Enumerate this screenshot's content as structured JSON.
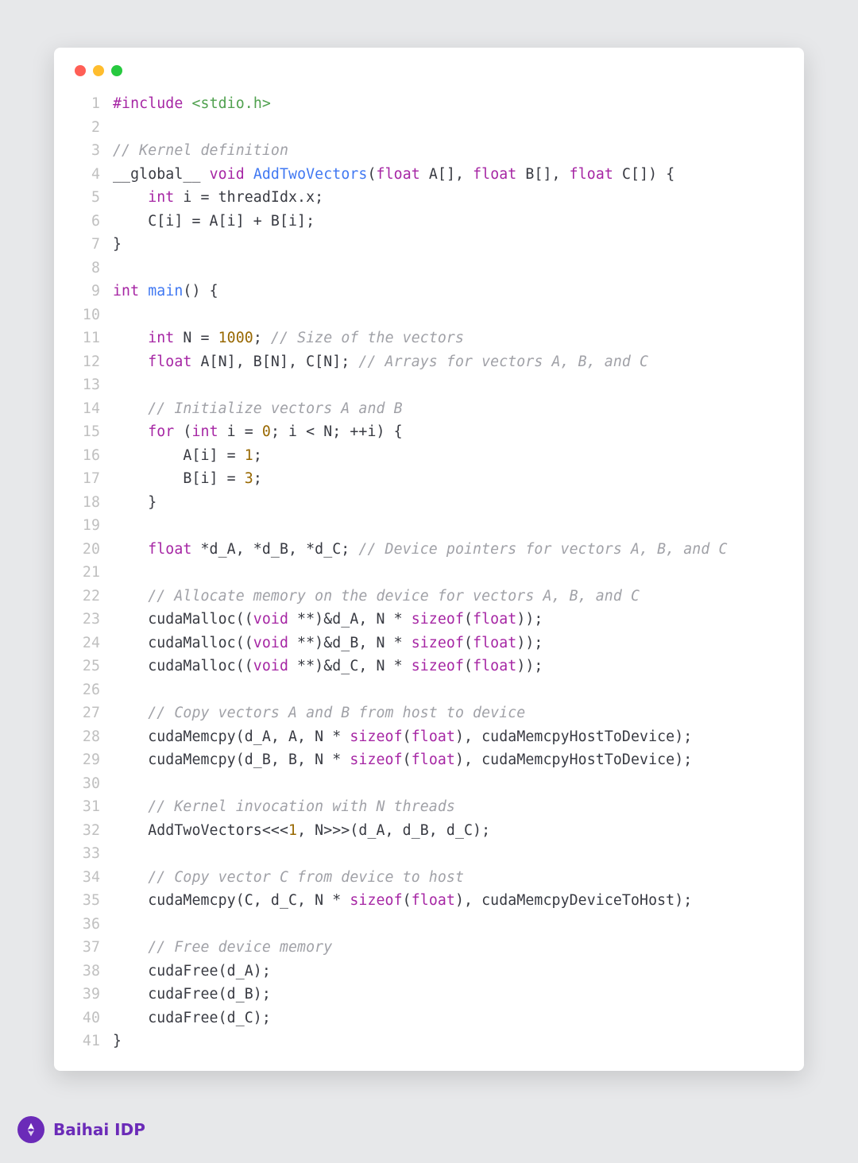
{
  "brand": "Baihai IDP",
  "code": {
    "lines": [
      {
        "n": 1,
        "tokens": [
          {
            "c": "pp",
            "t": "#include"
          },
          {
            "c": "plain",
            "t": " "
          },
          {
            "c": "inc",
            "t": "<stdio.h>"
          }
        ]
      },
      {
        "n": 2,
        "tokens": []
      },
      {
        "n": 3,
        "tokens": [
          {
            "c": "cm",
            "t": "// Kernel definition"
          }
        ]
      },
      {
        "n": 4,
        "tokens": [
          {
            "c": "sp",
            "t": "__global__"
          },
          {
            "c": "plain",
            "t": " "
          },
          {
            "c": "kw",
            "t": "void"
          },
          {
            "c": "plain",
            "t": " "
          },
          {
            "c": "fn",
            "t": "AddTwoVectors"
          },
          {
            "c": "plain",
            "t": "("
          },
          {
            "c": "kw",
            "t": "float"
          },
          {
            "c": "plain",
            "t": " A[], "
          },
          {
            "c": "kw",
            "t": "float"
          },
          {
            "c": "plain",
            "t": " B[], "
          },
          {
            "c": "kw",
            "t": "float"
          },
          {
            "c": "plain",
            "t": " C[]) {"
          }
        ]
      },
      {
        "n": 5,
        "tokens": [
          {
            "c": "plain",
            "t": "    "
          },
          {
            "c": "kw",
            "t": "int"
          },
          {
            "c": "plain",
            "t": " i = threadIdx.x;"
          }
        ]
      },
      {
        "n": 6,
        "tokens": [
          {
            "c": "plain",
            "t": "    C[i] = A[i] + B[i];"
          }
        ]
      },
      {
        "n": 7,
        "tokens": [
          {
            "c": "plain",
            "t": "}"
          }
        ]
      },
      {
        "n": 8,
        "tokens": []
      },
      {
        "n": 9,
        "tokens": [
          {
            "c": "kw",
            "t": "int"
          },
          {
            "c": "plain",
            "t": " "
          },
          {
            "c": "fn",
            "t": "main"
          },
          {
            "c": "plain",
            "t": "() {"
          }
        ]
      },
      {
        "n": 10,
        "tokens": []
      },
      {
        "n": 11,
        "tokens": [
          {
            "c": "plain",
            "t": "    "
          },
          {
            "c": "kw",
            "t": "int"
          },
          {
            "c": "plain",
            "t": " N = "
          },
          {
            "c": "num",
            "t": "1000"
          },
          {
            "c": "plain",
            "t": "; "
          },
          {
            "c": "cm",
            "t": "// Size of the vectors"
          }
        ]
      },
      {
        "n": 12,
        "tokens": [
          {
            "c": "plain",
            "t": "    "
          },
          {
            "c": "kw",
            "t": "float"
          },
          {
            "c": "plain",
            "t": " A[N], B[N], C[N]; "
          },
          {
            "c": "cm",
            "t": "// Arrays for vectors A, B, and C"
          }
        ]
      },
      {
        "n": 13,
        "tokens": []
      },
      {
        "n": 14,
        "tokens": [
          {
            "c": "plain",
            "t": "    "
          },
          {
            "c": "cm",
            "t": "// Initialize vectors A and B"
          }
        ]
      },
      {
        "n": 15,
        "tokens": [
          {
            "c": "plain",
            "t": "    "
          },
          {
            "c": "kw",
            "t": "for"
          },
          {
            "c": "plain",
            "t": " ("
          },
          {
            "c": "kw",
            "t": "int"
          },
          {
            "c": "plain",
            "t": " i = "
          },
          {
            "c": "num",
            "t": "0"
          },
          {
            "c": "plain",
            "t": "; i < N; ++i) {"
          }
        ]
      },
      {
        "n": 16,
        "tokens": [
          {
            "c": "plain",
            "t": "        A[i] = "
          },
          {
            "c": "num",
            "t": "1"
          },
          {
            "c": "plain",
            "t": ";"
          }
        ]
      },
      {
        "n": 17,
        "tokens": [
          {
            "c": "plain",
            "t": "        B[i] = "
          },
          {
            "c": "num",
            "t": "3"
          },
          {
            "c": "plain",
            "t": ";"
          }
        ]
      },
      {
        "n": 18,
        "tokens": [
          {
            "c": "plain",
            "t": "    }"
          }
        ]
      },
      {
        "n": 19,
        "tokens": []
      },
      {
        "n": 20,
        "tokens": [
          {
            "c": "plain",
            "t": "    "
          },
          {
            "c": "kw",
            "t": "float"
          },
          {
            "c": "plain",
            "t": " *d_A, *d_B, *d_C; "
          },
          {
            "c": "cm",
            "t": "// Device pointers for vectors A, B, and C"
          }
        ]
      },
      {
        "n": 21,
        "tokens": []
      },
      {
        "n": 22,
        "tokens": [
          {
            "c": "plain",
            "t": "    "
          },
          {
            "c": "cm",
            "t": "// Allocate memory on the device for vectors A, B, and C"
          }
        ]
      },
      {
        "n": 23,
        "tokens": [
          {
            "c": "plain",
            "t": "    cudaMalloc(("
          },
          {
            "c": "kw",
            "t": "void"
          },
          {
            "c": "plain",
            "t": " **)&d_A, N * "
          },
          {
            "c": "pp",
            "t": "sizeof"
          },
          {
            "c": "plain",
            "t": "("
          },
          {
            "c": "kw",
            "t": "float"
          },
          {
            "c": "plain",
            "t": "));"
          }
        ]
      },
      {
        "n": 24,
        "tokens": [
          {
            "c": "plain",
            "t": "    cudaMalloc(("
          },
          {
            "c": "kw",
            "t": "void"
          },
          {
            "c": "plain",
            "t": " **)&d_B, N * "
          },
          {
            "c": "pp",
            "t": "sizeof"
          },
          {
            "c": "plain",
            "t": "("
          },
          {
            "c": "kw",
            "t": "float"
          },
          {
            "c": "plain",
            "t": "));"
          }
        ]
      },
      {
        "n": 25,
        "tokens": [
          {
            "c": "plain",
            "t": "    cudaMalloc(("
          },
          {
            "c": "kw",
            "t": "void"
          },
          {
            "c": "plain",
            "t": " **)&d_C, N * "
          },
          {
            "c": "pp",
            "t": "sizeof"
          },
          {
            "c": "plain",
            "t": "("
          },
          {
            "c": "kw",
            "t": "float"
          },
          {
            "c": "plain",
            "t": "));"
          }
        ]
      },
      {
        "n": 26,
        "tokens": []
      },
      {
        "n": 27,
        "tokens": [
          {
            "c": "plain",
            "t": "    "
          },
          {
            "c": "cm",
            "t": "// Copy vectors A and B from host to device"
          }
        ]
      },
      {
        "n": 28,
        "tokens": [
          {
            "c": "plain",
            "t": "    cudaMemcpy(d_A, A, N * "
          },
          {
            "c": "pp",
            "t": "sizeof"
          },
          {
            "c": "plain",
            "t": "("
          },
          {
            "c": "kw",
            "t": "float"
          },
          {
            "c": "plain",
            "t": "), cudaMemcpyHostToDevice);"
          }
        ]
      },
      {
        "n": 29,
        "tokens": [
          {
            "c": "plain",
            "t": "    cudaMemcpy(d_B, B, N * "
          },
          {
            "c": "pp",
            "t": "sizeof"
          },
          {
            "c": "plain",
            "t": "("
          },
          {
            "c": "kw",
            "t": "float"
          },
          {
            "c": "plain",
            "t": "), cudaMemcpyHostToDevice);"
          }
        ]
      },
      {
        "n": 30,
        "tokens": []
      },
      {
        "n": 31,
        "tokens": [
          {
            "c": "plain",
            "t": "    "
          },
          {
            "c": "cm",
            "t": "// Kernel invocation with N threads"
          }
        ]
      },
      {
        "n": 32,
        "tokens": [
          {
            "c": "plain",
            "t": "    AddTwoVectors<<<"
          },
          {
            "c": "num",
            "t": "1"
          },
          {
            "c": "plain",
            "t": ", N>>>(d_A, d_B, d_C);"
          }
        ]
      },
      {
        "n": 33,
        "tokens": []
      },
      {
        "n": 34,
        "tokens": [
          {
            "c": "plain",
            "t": "    "
          },
          {
            "c": "cm",
            "t": "// Copy vector C from device to host"
          }
        ]
      },
      {
        "n": 35,
        "tokens": [
          {
            "c": "plain",
            "t": "    cudaMemcpy(C, d_C, N * "
          },
          {
            "c": "pp",
            "t": "sizeof"
          },
          {
            "c": "plain",
            "t": "("
          },
          {
            "c": "kw",
            "t": "float"
          },
          {
            "c": "plain",
            "t": "), cudaMemcpyDeviceToHost);"
          }
        ]
      },
      {
        "n": 36,
        "tokens": []
      },
      {
        "n": 37,
        "tokens": [
          {
            "c": "plain",
            "t": "    "
          },
          {
            "c": "cm",
            "t": "// Free device memory"
          }
        ]
      },
      {
        "n": 38,
        "tokens": [
          {
            "c": "plain",
            "t": "    cudaFree(d_A);"
          }
        ]
      },
      {
        "n": 39,
        "tokens": [
          {
            "c": "plain",
            "t": "    cudaFree(d_B);"
          }
        ]
      },
      {
        "n": 40,
        "tokens": [
          {
            "c": "plain",
            "t": "    cudaFree(d_C);"
          }
        ]
      },
      {
        "n": 41,
        "tokens": [
          {
            "c": "plain",
            "t": "}"
          }
        ]
      }
    ]
  }
}
